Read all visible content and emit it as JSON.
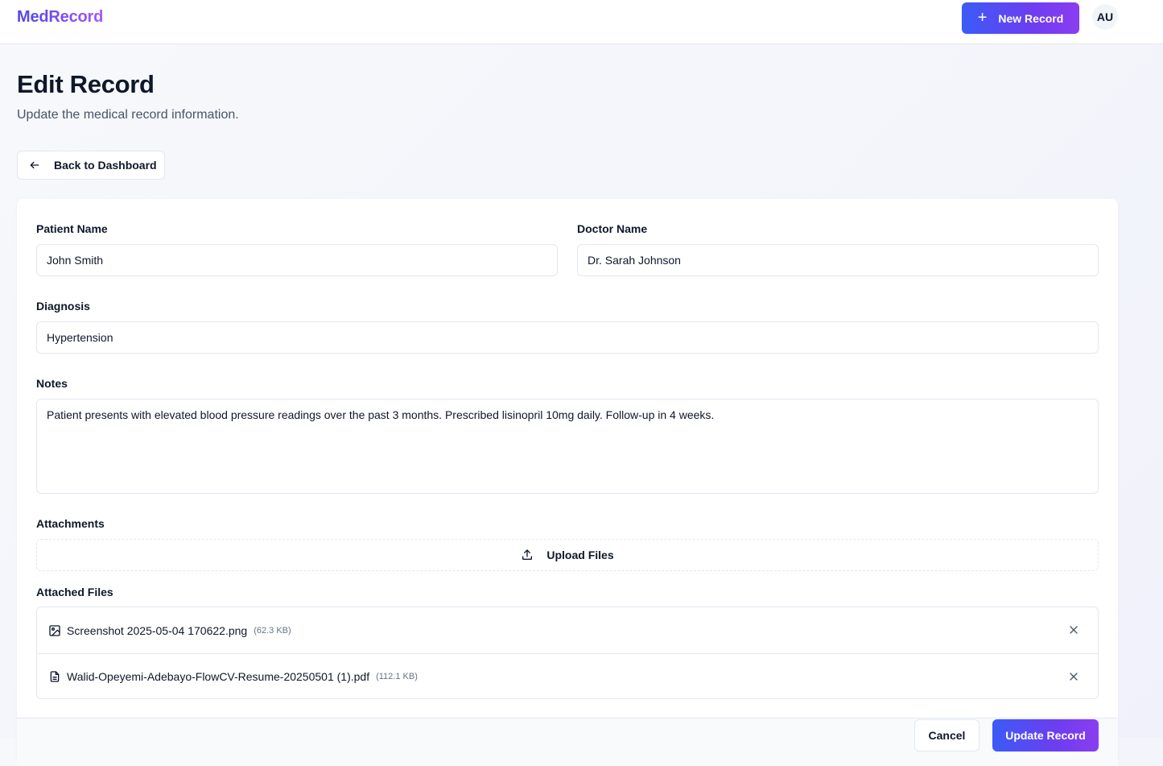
{
  "header": {
    "logo": "MedRecord",
    "new_record_label": "New Record",
    "avatar_initials": "AU"
  },
  "page": {
    "title": "Edit Record",
    "subtitle": "Update the medical record information.",
    "back_label": "Back to Dashboard"
  },
  "form": {
    "patient_name": {
      "label": "Patient Name",
      "value": "John Smith"
    },
    "doctor_name": {
      "label": "Doctor Name",
      "value": "Dr. Sarah Johnson"
    },
    "diagnosis": {
      "label": "Diagnosis",
      "value": "Hypertension"
    },
    "notes": {
      "label": "Notes",
      "value": "Patient presents with elevated blood pressure readings over the past 3 months. Prescribed lisinopril 10mg daily. Follow-up in 4 weeks."
    },
    "attachments_label": "Attachments",
    "upload_label": "Upload Files",
    "attached_files_label": "Attached Files",
    "files": [
      {
        "name": "Screenshot 2025-05-04 170622.png",
        "size": "(62.3 KB)",
        "icon": "image-icon"
      },
      {
        "name": "Walid-Opeyemi-Adebayo-FlowCV-Resume-20250501 (1).pdf",
        "size": "(112.1 KB)",
        "icon": "document-icon"
      }
    ]
  },
  "actions": {
    "cancel_label": "Cancel",
    "update_label": "Update Record"
  },
  "colors": {
    "accent_start": "#3b5bf6",
    "accent_end": "#8b3df0"
  }
}
